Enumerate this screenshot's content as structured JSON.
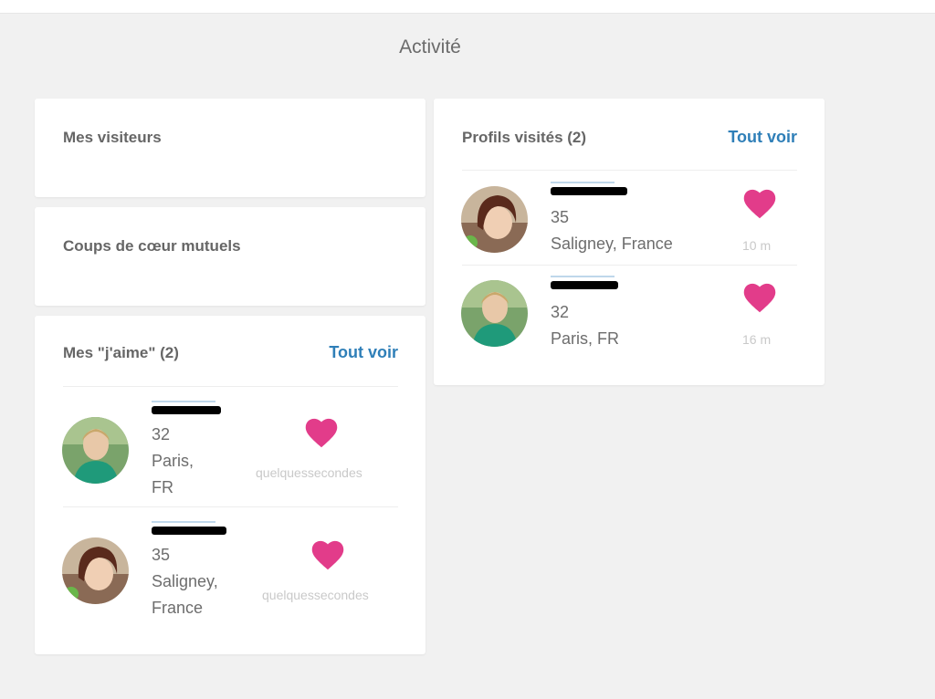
{
  "page": {
    "title": "Activité"
  },
  "colors": {
    "accent": "#2f7fb8",
    "heart": "#e23c8a",
    "background": "#f1f1f1"
  },
  "visitors": {
    "title": "Mes visiteurs"
  },
  "mutual": {
    "title": "Coups de cœur mutuels"
  },
  "likes": {
    "title": "Mes \"j'aime\" (2)",
    "see_all": "Tout voir",
    "items": [
      {
        "age": "32",
        "city": "Paris,",
        "country": "FR",
        "time": "quelquessecondes",
        "icon": "heart-icon"
      },
      {
        "age": "35",
        "city": "Saligney,",
        "country": "France",
        "time": "quelquessecondes",
        "icon": "heart-icon"
      }
    ]
  },
  "visited": {
    "title": "Profils visités (2)",
    "see_all": "Tout voir",
    "items": [
      {
        "age": "35",
        "location": "Saligney, France",
        "time": "10 m",
        "icon": "heart-icon"
      },
      {
        "age": "32",
        "location": "Paris, FR",
        "time": "16 m",
        "icon": "heart-icon"
      }
    ]
  }
}
